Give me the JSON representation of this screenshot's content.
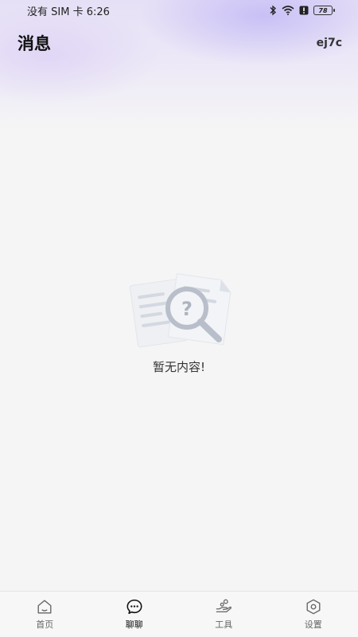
{
  "status_bar": {
    "carrier_time": "没有 SIM 卡 6:26",
    "battery": "78",
    "icons": [
      "bluetooth-icon",
      "wifi-icon",
      "alert-icon",
      "battery-icon"
    ]
  },
  "header": {
    "title": "消息",
    "user": "ej7c"
  },
  "empty_state": {
    "icon": "document-search-icon",
    "text": "暂无内容!"
  },
  "tabs": [
    {
      "label": "首页",
      "icon": "home-icon",
      "active": false
    },
    {
      "label": "聊聊",
      "icon": "chat-icon",
      "active": true
    },
    {
      "label": "工具",
      "icon": "tools-icon",
      "active": false
    },
    {
      "label": "设置",
      "icon": "settings-icon",
      "active": false
    }
  ],
  "colors": {
    "background": "#f5f5f5",
    "header_gradient": "#e6e0f6",
    "active_tab": "#111111",
    "inactive_tab": "#666666"
  }
}
